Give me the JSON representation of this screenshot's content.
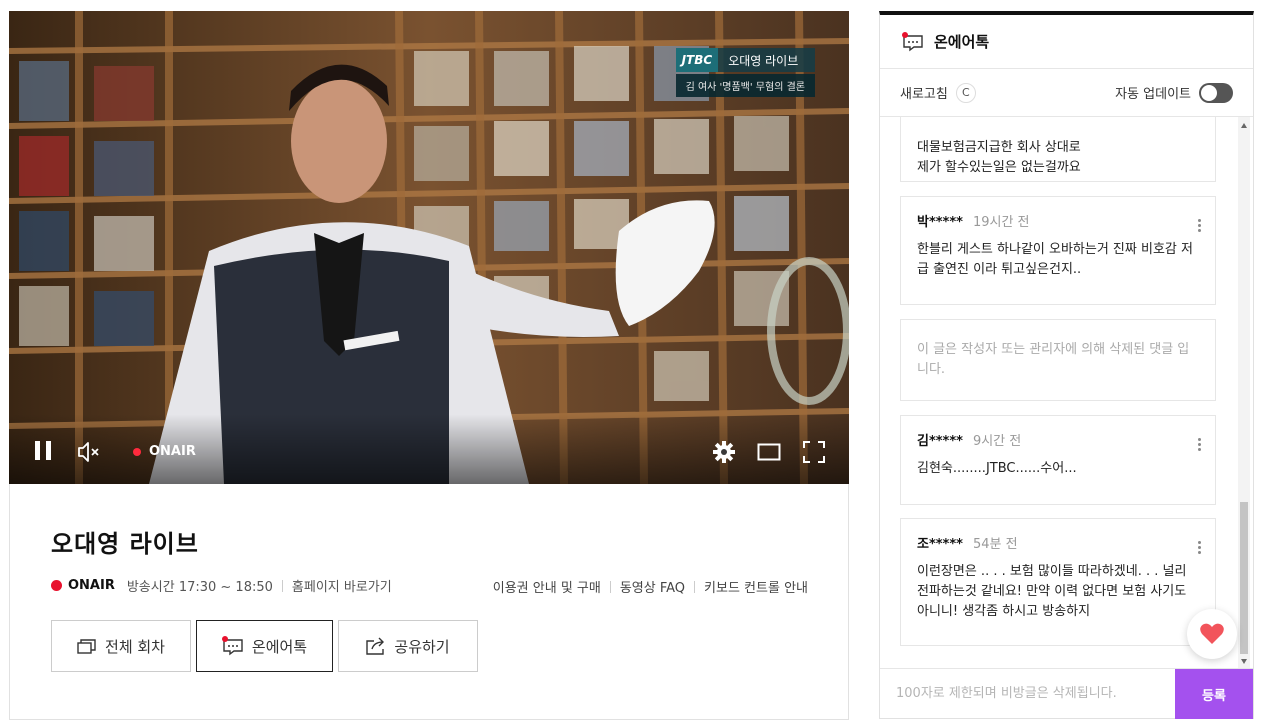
{
  "player": {
    "logo": {
      "brand": "JTBC",
      "title": "오대영 라이브",
      "subtitle": "김 여사 '명품백' 무혐의 결론"
    },
    "live_label": "ONAIR"
  },
  "program": {
    "title": "오대영 라이브",
    "onair_label": "ONAIR",
    "airtime": "방송시간  17:30 ~ 18:50",
    "homepage_link": "홈페이지 바로가기",
    "links": [
      "이용권 안내 및 구매",
      "동영상 FAQ",
      "키보드 컨트롤 안내"
    ],
    "buttons": {
      "episodes": "전체 회차",
      "onair_talk": "온에어톡",
      "share": "공유하기"
    }
  },
  "chat": {
    "title": "온에어톡",
    "refresh_label": "새로고침",
    "refresh_icon": "C",
    "auto_update_label": "자동 업데이트",
    "auto_update_on": false,
    "comments": [
      {
        "user": "",
        "time": "",
        "text": "대물보험금지급한 회사 상대로\n제가 할수있는일은 없는걸까요",
        "deleted": false
      },
      {
        "user": "박*****",
        "time": "19시간 전",
        "text": "한블리 게스트 하나같이 오바하는거 진짜 비호감 저급 출연진 이라 튀고싶은건지..",
        "deleted": false
      },
      {
        "user": "",
        "time": "",
        "text": "이 글은 작성자 또는 관리자에 의해 삭제된 댓글 입니다.",
        "deleted": true
      },
      {
        "user": "김*****",
        "time": "9시간 전",
        "text": "김현숙........JTBC......수어...",
        "deleted": false
      },
      {
        "user": "조*****",
        "time": "54분 전",
        "text": "이런장면은 .. . . 보험 많이들 따라하겠네. . . 널리 전파하는것 같네요! 만약 이력 없다면 보험 사기도 아니니! 생각좀 하시고 방송하지",
        "deleted": false
      }
    ],
    "input_placeholder": "100자로 제한되며 비방글은 삭제됩니다.",
    "submit_label": "등록"
  },
  "colors": {
    "live_red": "#e8112d",
    "submit_purple": "#a451ee",
    "heart_red": "#f2545b"
  }
}
